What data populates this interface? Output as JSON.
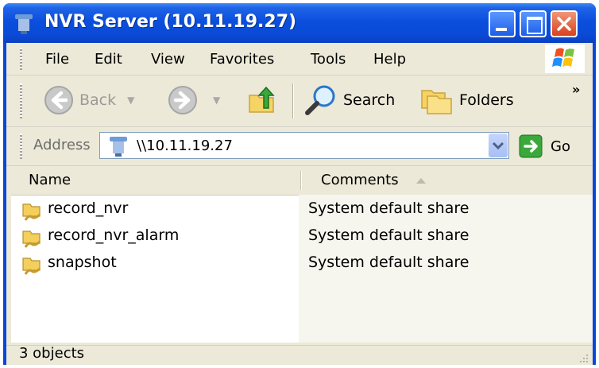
{
  "window": {
    "title": "NVR Server (10.11.19.27)"
  },
  "menu": [
    "File",
    "Edit",
    "View",
    "Favorites",
    "Tools",
    "Help"
  ],
  "toolbar": {
    "back": "Back",
    "search": "Search",
    "folders": "Folders",
    "chevron": "»"
  },
  "address": {
    "label": "Address",
    "value": "\\\\10.11.19.27",
    "go": "Go"
  },
  "columns": {
    "name": "Name",
    "comments": "Comments"
  },
  "items": [
    {
      "name": "record_nvr",
      "comment": "System default share"
    },
    {
      "name": "record_nvr_alarm",
      "comment": "System default share"
    },
    {
      "name": "snapshot",
      "comment": "System default share"
    }
  ],
  "status": {
    "text": "3 objects"
  },
  "colors": {
    "titlebar": "#0a4ad6",
    "chrome": "#ece9d8",
    "close": "#d8401e"
  }
}
